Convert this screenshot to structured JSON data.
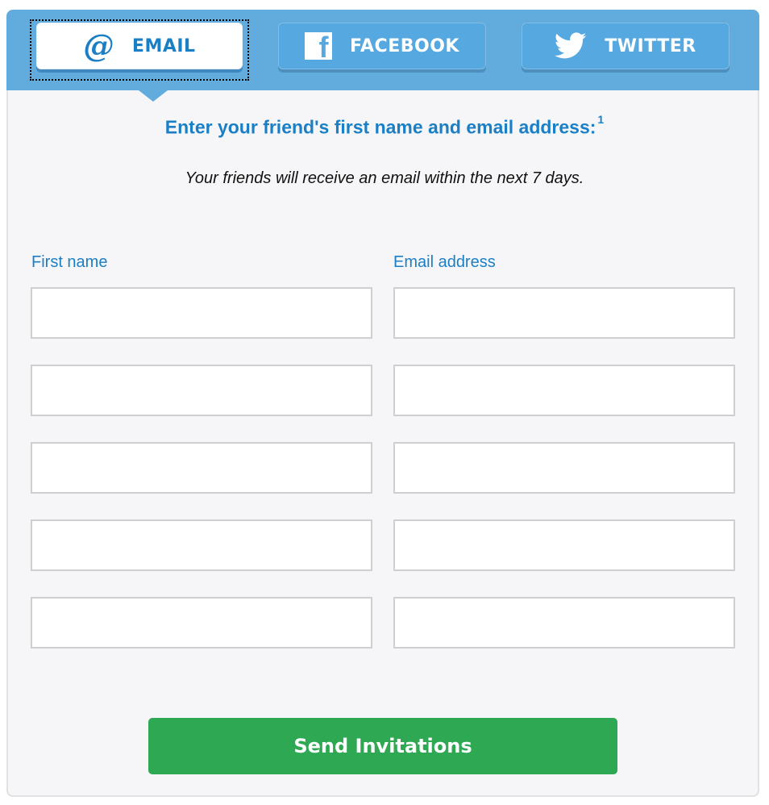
{
  "tabs": [
    {
      "id": "email",
      "label": "EMAIL",
      "icon": "at-sign-icon",
      "active": true
    },
    {
      "id": "facebook",
      "label": "FACEBOOK",
      "icon": "facebook-icon",
      "active": false
    },
    {
      "id": "twitter",
      "label": "TWITTER",
      "icon": "twitter-bird-icon",
      "active": false
    }
  ],
  "form": {
    "heading": "Enter your friend's first name and email address:",
    "heading_footnote": "1",
    "subtext": "Your friends will receive an email within the next 7 days.",
    "first_name_label": "First name",
    "email_label": "Email address",
    "rows": [
      {
        "first_name": "",
        "email": ""
      },
      {
        "first_name": "",
        "email": ""
      },
      {
        "first_name": "",
        "email": ""
      },
      {
        "first_name": "",
        "email": ""
      },
      {
        "first_name": "",
        "email": ""
      }
    ],
    "submit_label": "Send Invitations"
  },
  "colors": {
    "tab_bar": "#62abdd",
    "accent_blue": "#1a7fc4",
    "submit_green": "#2ea853"
  }
}
